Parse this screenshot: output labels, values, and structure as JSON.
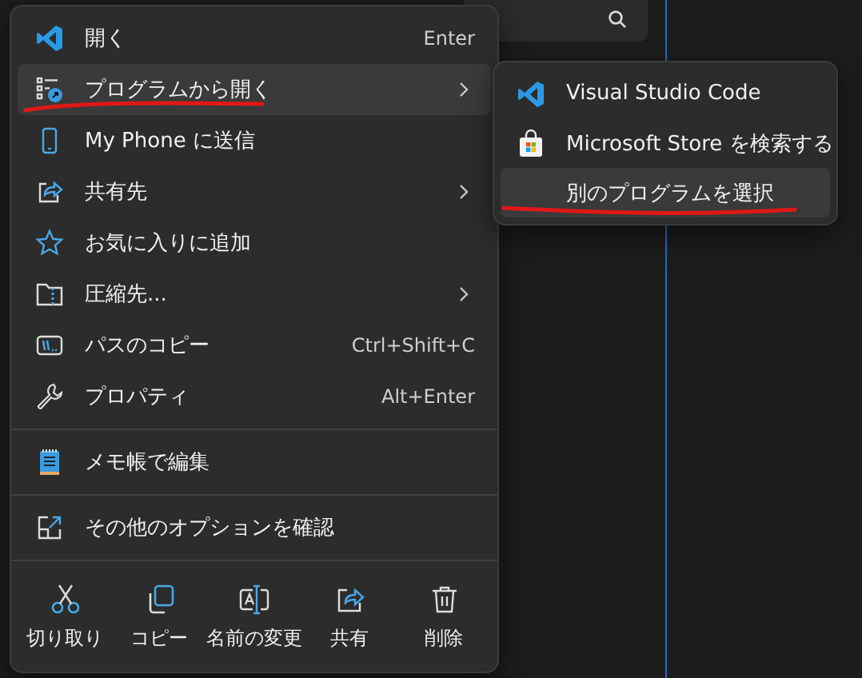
{
  "menu": {
    "sections": [
      [
        {
          "label": "開く",
          "shortcut": "Enter",
          "submenu": false,
          "selected": false
        },
        {
          "label": "プログラムから開く",
          "submenu": true,
          "selected": true
        },
        {
          "label": "My Phone に送信",
          "submenu": false,
          "selected": false
        },
        {
          "label": "共有先",
          "submenu": true,
          "selected": false
        },
        {
          "label": "お気に入りに追加",
          "submenu": false,
          "selected": false
        },
        {
          "label": "圧縮先...",
          "submenu": true,
          "selected": false
        },
        {
          "label": "パスのコピー",
          "shortcut": "Ctrl+Shift+C",
          "submenu": false,
          "selected": false
        },
        {
          "label": "プロパティ",
          "shortcut": "Alt+Enter",
          "submenu": false,
          "selected": false
        }
      ],
      [
        {
          "label": "メモ帳で編集",
          "submenu": false,
          "selected": false
        }
      ],
      [
        {
          "label": "その他のオプションを確認",
          "submenu": false,
          "selected": false
        }
      ]
    ],
    "actions": [
      {
        "label": "切り取り"
      },
      {
        "label": "コピー"
      },
      {
        "label": "名前の変更"
      },
      {
        "label": "共有"
      },
      {
        "label": "削除"
      }
    ]
  },
  "submenu": {
    "items": [
      {
        "label": "Visual Studio Code",
        "selected": false
      },
      {
        "label": "Microsoft Store を検索する",
        "selected": false
      },
      {
        "label": "別のプログラムを選択",
        "selected": true
      }
    ]
  }
}
